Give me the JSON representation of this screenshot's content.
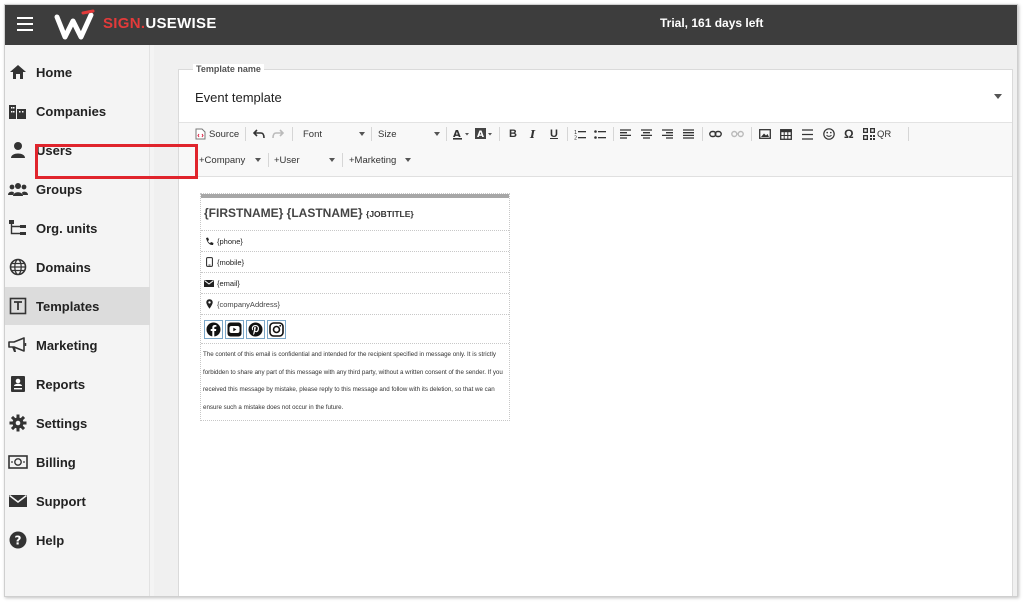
{
  "header": {
    "brand_part1": "SIGN.",
    "brand_part2": "USEWISE",
    "trial_text": "Trial, 161 days left"
  },
  "sidebar": {
    "items": [
      {
        "label": "Home",
        "icon": "home-icon"
      },
      {
        "label": "Companies",
        "icon": "companies-icon"
      },
      {
        "label": "Users",
        "icon": "user-icon"
      },
      {
        "label": "Groups",
        "icon": "groups-icon"
      },
      {
        "label": "Org. units",
        "icon": "org-units-icon"
      },
      {
        "label": "Domains",
        "icon": "globe-icon"
      },
      {
        "label": "Templates",
        "icon": "template-icon",
        "active": true
      },
      {
        "label": "Marketing",
        "icon": "megaphone-icon"
      },
      {
        "label": "Reports",
        "icon": "report-icon"
      },
      {
        "label": "Settings",
        "icon": "gear-icon"
      },
      {
        "label": "Billing",
        "icon": "billing-icon"
      },
      {
        "label": "Support",
        "icon": "mail-icon"
      },
      {
        "label": "Help",
        "icon": "help-icon"
      }
    ]
  },
  "template": {
    "label": "Template name",
    "value": "Event template"
  },
  "toolbar": {
    "source": "Source",
    "font": "Font",
    "size": "Size",
    "qr": "QR",
    "company": "+Company",
    "user": "+User",
    "marketing": "+Marketing"
  },
  "signature": {
    "name": "{FIRSTNAME} {LASTNAME}",
    "jobtitle": "{JOBTITLE}",
    "phone": "{phone}",
    "mobile": "{mobile}",
    "email": "{email}",
    "address": "{companyAddress}",
    "disclaimer": "The content of this email is confidential and intended for the recipient specified in message only. It is strictly forbidden to share any part of this message with any third party, without a written consent of the sender. If you received this message by mistake, please reply to this message and follow with its deletion, so that we can ensure such a mistake does not occur in the future."
  },
  "colors": {
    "topbar": "#3d3d3d",
    "brand_accent": "#e33a3a",
    "highlight_box": "#e0242c",
    "active_nav": "#dcdcdc"
  }
}
